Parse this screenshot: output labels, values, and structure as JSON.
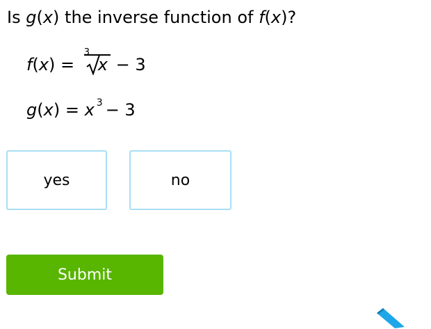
{
  "question": {
    "prefix": "Is ",
    "g_fn": "g",
    "g_open": "(",
    "g_var": "x",
    "g_close": ")",
    "middle": " the inverse function of ",
    "f_fn": "f",
    "f_open": "(",
    "f_var": "x",
    "f_close": ")",
    "suffix": "?"
  },
  "equation_f": {
    "fn": "f",
    "open": "(",
    "var": "x",
    "close": ")",
    "equals": " = ",
    "root_index": "3",
    "radicand": "x",
    "tail": " − 3"
  },
  "equation_g": {
    "fn": "g",
    "open": "(",
    "var": "x",
    "close": ")",
    "equals": " = ",
    "base": "x",
    "exponent": "3",
    "tail": "− 3"
  },
  "choices": {
    "yes_label": "yes",
    "no_label": "no"
  },
  "submit": {
    "label": "Submit"
  },
  "colors": {
    "choice_border": "#a8dff4",
    "submit_bg": "#58b500",
    "pencil": "#1ea7e8"
  },
  "icons": {
    "pencil": "pencil-icon"
  }
}
